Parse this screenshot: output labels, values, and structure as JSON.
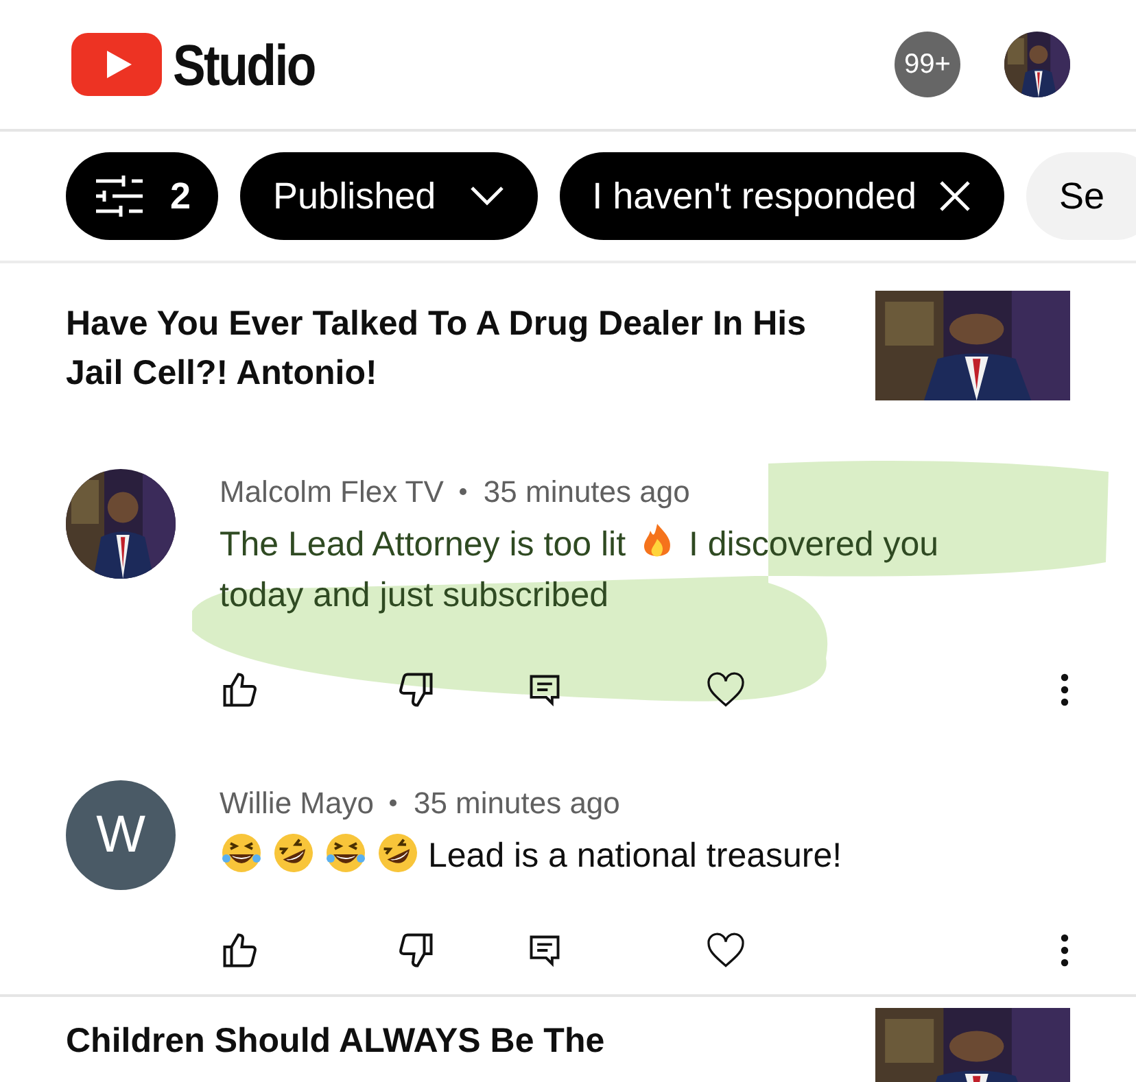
{
  "header": {
    "logo_text": "Studio",
    "notifications_badge": "99+"
  },
  "filters": [
    {
      "kind": "count",
      "label": "2"
    },
    {
      "kind": "dropdown",
      "label": "Published"
    },
    {
      "kind": "removable",
      "label": "I haven't responded"
    },
    {
      "kind": "plain",
      "label": "Se"
    }
  ],
  "videos": [
    {
      "title": "Have You Ever Talked To A Drug Dealer In His Jail Cell?! Antonio!",
      "comments": [
        {
          "author": "Malcolm Flex TV",
          "time": "35 minutes ago",
          "marker_highlight": true,
          "parts": [
            {
              "kind": "text",
              "text": "The Lead Attorney is too lit"
            },
            {
              "kind": "fire"
            },
            {
              "kind": "text",
              "text": "I discovered you"
            },
            {
              "kind": "break"
            },
            {
              "kind": "text",
              "text": "today and just subscribed"
            }
          ]
        },
        {
          "author": "Willie Mayo",
          "time": "35 minutes ago",
          "avatar": {
            "kind": "letter",
            "letter": "W"
          },
          "marker_highlight": false,
          "parts": [
            {
              "kind": "joy"
            },
            {
              "kind": "rofl"
            },
            {
              "kind": "joy"
            },
            {
              "kind": "rofl"
            },
            {
              "kind": "text",
              "text": "Lead is a national treasure!"
            }
          ]
        }
      ]
    },
    {
      "title": "Children Should ALWAYS Be The"
    }
  ]
}
